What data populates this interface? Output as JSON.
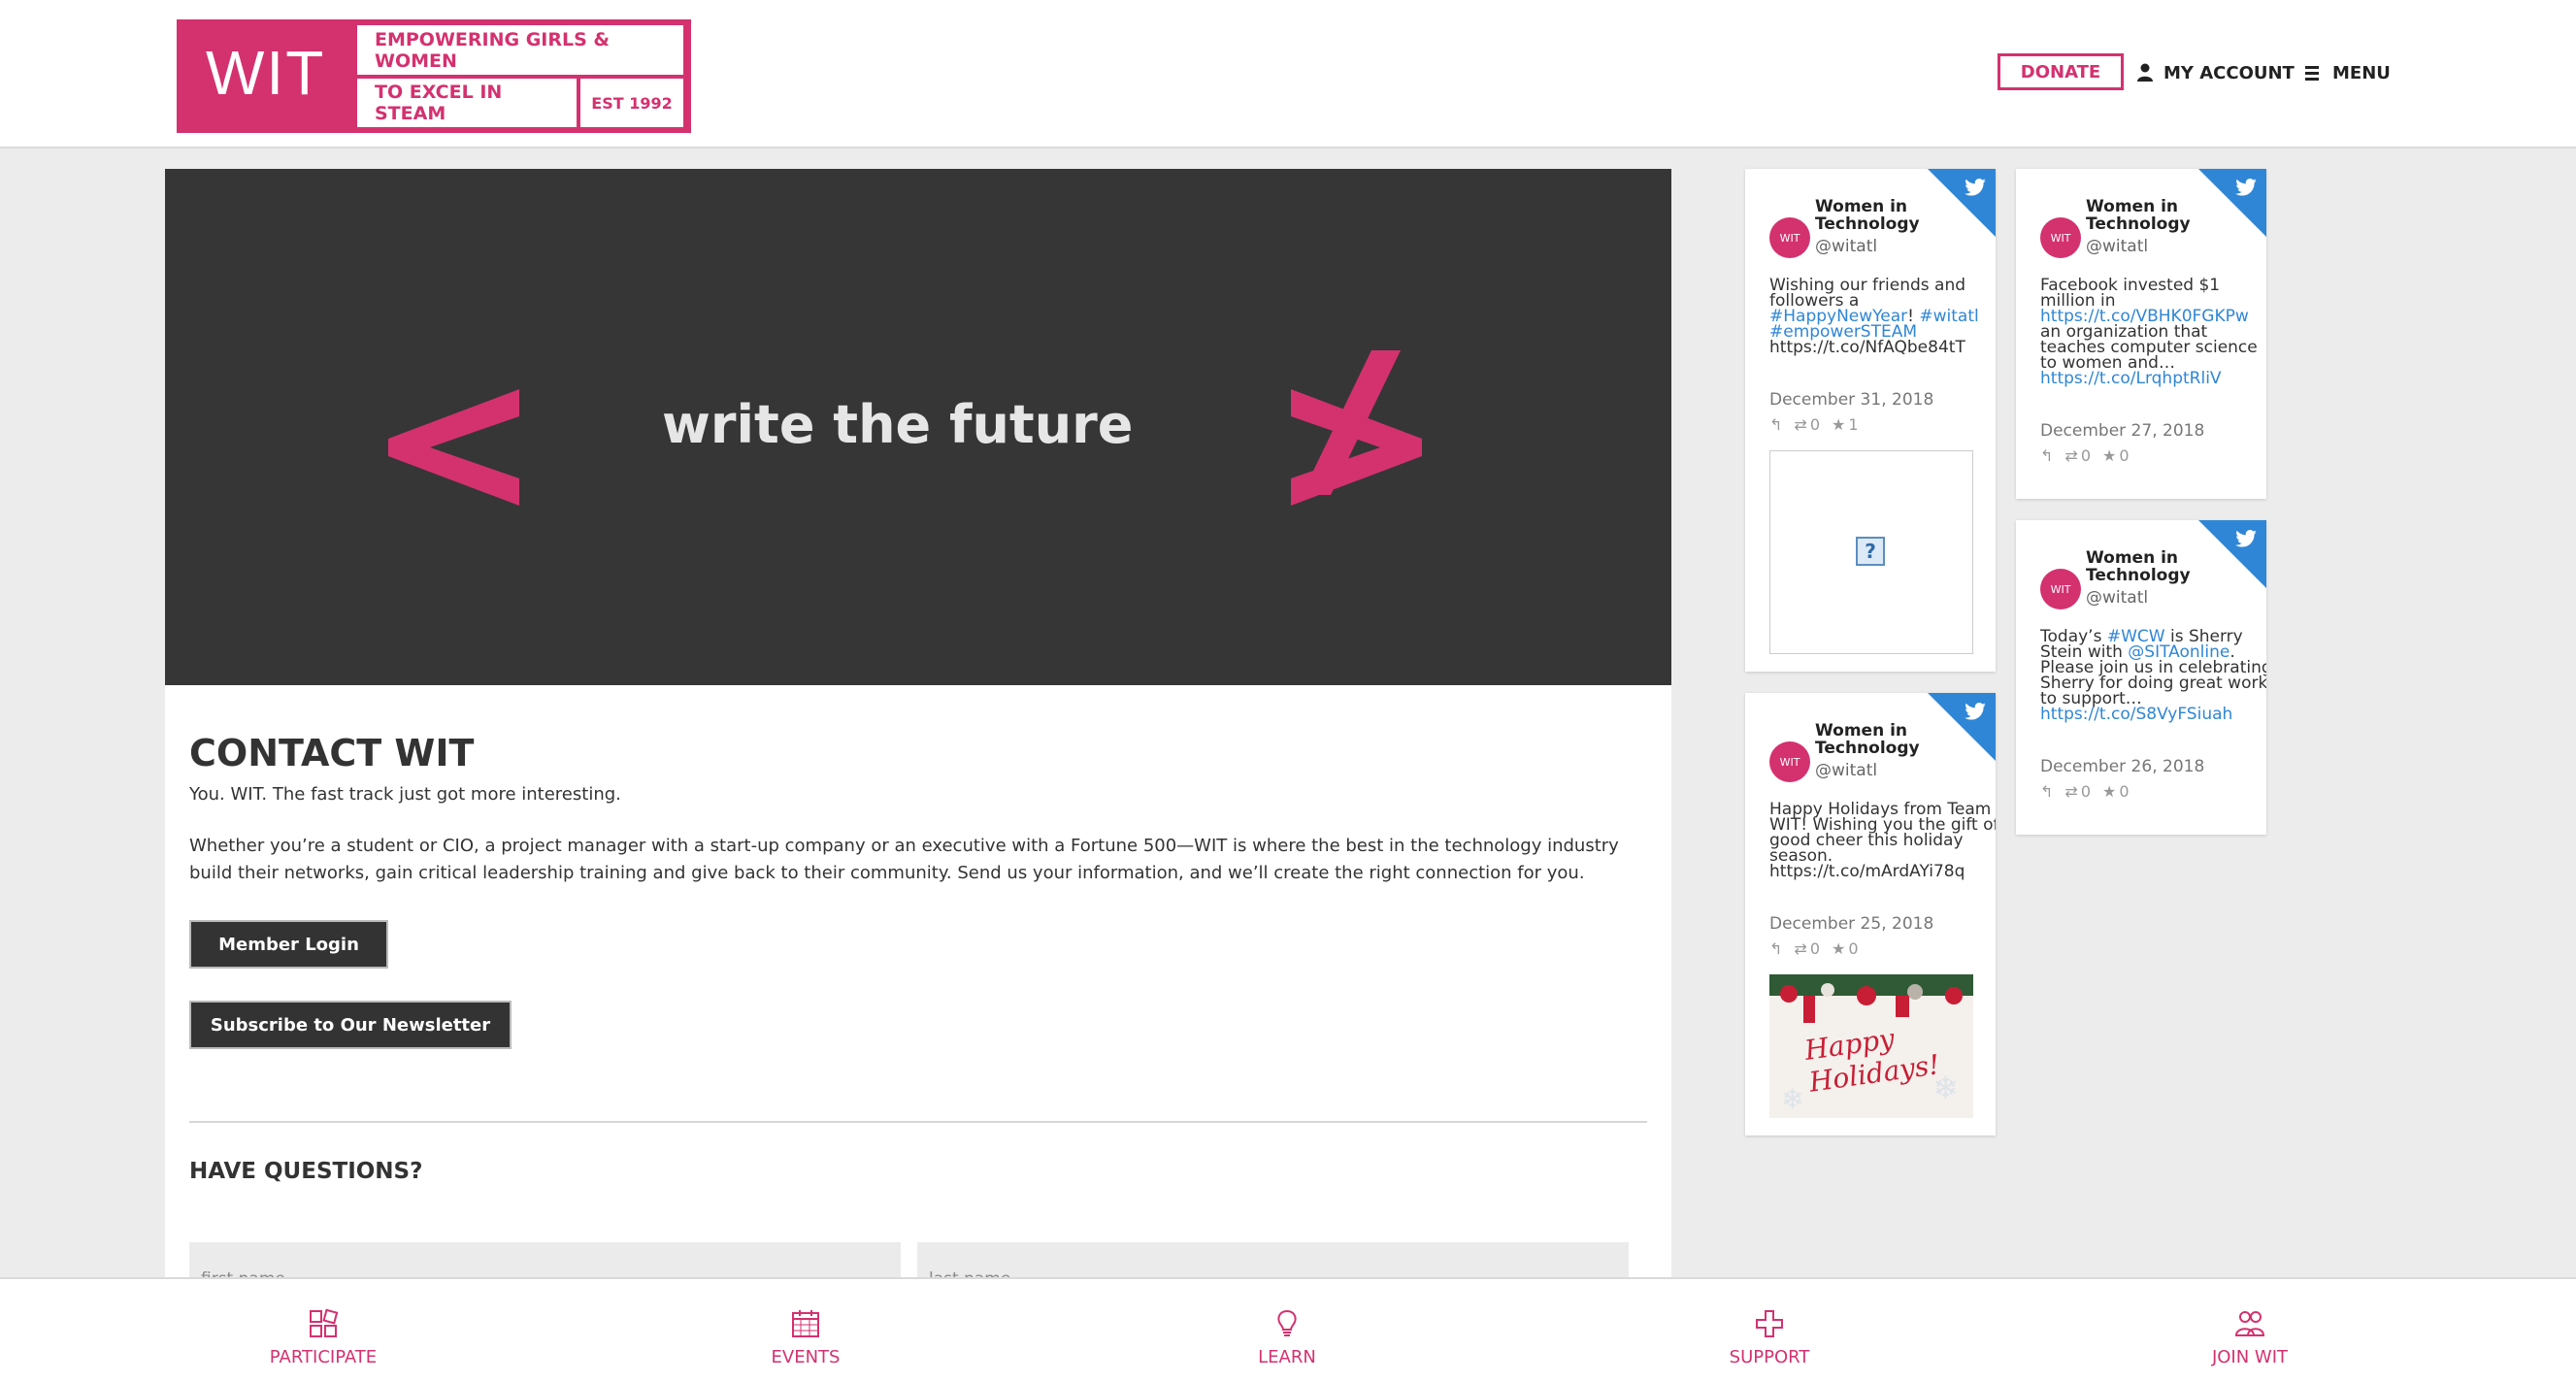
{
  "logo": {
    "wit": "WIT",
    "line1": "EMPOWERING GIRLS & WOMEN",
    "line2": "TO EXCEL IN STEAM",
    "est": "EST 1992"
  },
  "header": {
    "donate_label": "DONATE",
    "account_label": "MY ACCOUNT",
    "menu_label": "MENU"
  },
  "hero": {
    "text": "write the future"
  },
  "contact": {
    "title": "CONTACT WIT",
    "tagline": "You. WIT. The fast track just got more interesting.",
    "description": "Whether you’re a student or CIO, a project manager with a start-up company or an executive with a Fortune 500—WIT is where the best in the technology industry build their networks, gain critical leadership training and give back to their community. Send us your information, and we’ll create the right connection for you.",
    "member_login_label": "Member Login",
    "subscribe_label": "Subscribe to Our Newsletter",
    "questions_title": "HAVE QUESTIONS?",
    "first_name_placeholder": "first name",
    "last_name_placeholder": "last name"
  },
  "tweets": [
    {
      "name": "Women in Technology",
      "handle": "@witatl",
      "avatar_text": "WIT",
      "body_parts": [
        {
          "text": "Wishing our friends and followers a ",
          "link": false
        },
        {
          "text": "#HappyNewYear",
          "link": true
        },
        {
          "text": "! ",
          "link": false
        },
        {
          "text": "#witatl",
          "link": true
        },
        {
          "text": " ",
          "link": false
        },
        {
          "text": "#empowerSTEAM",
          "link": true
        },
        {
          "text": " https://t.co/NfAQbe84tT",
          "link": false
        }
      ],
      "date": "December 31, 2018",
      "retweets": "0",
      "likes": "1",
      "media": "broken-image"
    },
    {
      "name": "Women in Technology",
      "handle": "@witatl",
      "avatar_text": "WIT",
      "body_parts": [
        {
          "text": "Happy Holidays from Team WIT! Wishing you the gift of good cheer this holiday season. https://t.co/mArdAYi78q",
          "link": false
        }
      ],
      "date": "December 25, 2018",
      "retweets": "0",
      "likes": "0",
      "media": "holiday-image",
      "media_text": "Happy Holidays!"
    },
    {
      "name": "Women in Technology",
      "handle": "@witatl",
      "avatar_text": "WIT",
      "body_parts": [
        {
          "text": "Facebook invested $1 million in ",
          "link": false
        },
        {
          "text": "https://t.co/VBHK0FGKPw",
          "link": true
        },
        {
          "text": " an organization that teaches computer science to women and… ",
          "link": false
        },
        {
          "text": "https://t.co/LrqhptRliV",
          "link": true
        }
      ],
      "date": "December 27, 2018",
      "retweets": "0",
      "likes": "0"
    },
    {
      "name": "Women in Technology",
      "handle": "@witatl",
      "avatar_text": "WIT",
      "body_parts": [
        {
          "text": "Today’s ",
          "link": false
        },
        {
          "text": "#WCW",
          "link": true
        },
        {
          "text": " is Sherry Stein with ",
          "link": false
        },
        {
          "text": "@SITAonline",
          "link": true
        },
        {
          "text": ". Please join us in celebrating Sherry for doing great work to support… ",
          "link": false
        },
        {
          "text": "https://t.co/S8VyFSiuah",
          "link": true
        }
      ],
      "date": "December 26, 2018",
      "retweets": "0",
      "likes": "0"
    }
  ],
  "bottom_nav": [
    {
      "label": "PARTICIPATE",
      "icon": "participate-icon"
    },
    {
      "label": "EVENTS",
      "icon": "calendar-icon"
    },
    {
      "label": "LEARN",
      "icon": "lightbulb-icon"
    },
    {
      "label": "SUPPORT",
      "icon": "cross-icon"
    },
    {
      "label": "JOIN WIT",
      "icon": "people-icon"
    }
  ],
  "colors": {
    "brand": "#d4316f",
    "twitter": "#2f86d6",
    "dark": "#333333"
  }
}
